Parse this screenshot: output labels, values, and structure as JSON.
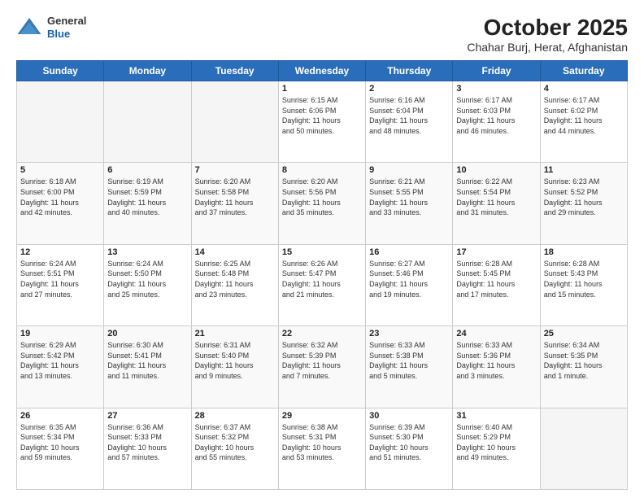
{
  "header": {
    "logo_general": "General",
    "logo_blue": "Blue",
    "title": "October 2025",
    "subtitle": "Chahar Burj, Herat, Afghanistan"
  },
  "days_of_week": [
    "Sunday",
    "Monday",
    "Tuesday",
    "Wednesday",
    "Thursday",
    "Friday",
    "Saturday"
  ],
  "weeks": [
    [
      {
        "day": "",
        "info": ""
      },
      {
        "day": "",
        "info": ""
      },
      {
        "day": "",
        "info": ""
      },
      {
        "day": "1",
        "info": "Sunrise: 6:15 AM\nSunset: 6:06 PM\nDaylight: 11 hours\nand 50 minutes."
      },
      {
        "day": "2",
        "info": "Sunrise: 6:16 AM\nSunset: 6:04 PM\nDaylight: 11 hours\nand 48 minutes."
      },
      {
        "day": "3",
        "info": "Sunrise: 6:17 AM\nSunset: 6:03 PM\nDaylight: 11 hours\nand 46 minutes."
      },
      {
        "day": "4",
        "info": "Sunrise: 6:17 AM\nSunset: 6:02 PM\nDaylight: 11 hours\nand 44 minutes."
      }
    ],
    [
      {
        "day": "5",
        "info": "Sunrise: 6:18 AM\nSunset: 6:00 PM\nDaylight: 11 hours\nand 42 minutes."
      },
      {
        "day": "6",
        "info": "Sunrise: 6:19 AM\nSunset: 5:59 PM\nDaylight: 11 hours\nand 40 minutes."
      },
      {
        "day": "7",
        "info": "Sunrise: 6:20 AM\nSunset: 5:58 PM\nDaylight: 11 hours\nand 37 minutes."
      },
      {
        "day": "8",
        "info": "Sunrise: 6:20 AM\nSunset: 5:56 PM\nDaylight: 11 hours\nand 35 minutes."
      },
      {
        "day": "9",
        "info": "Sunrise: 6:21 AM\nSunset: 5:55 PM\nDaylight: 11 hours\nand 33 minutes."
      },
      {
        "day": "10",
        "info": "Sunrise: 6:22 AM\nSunset: 5:54 PM\nDaylight: 11 hours\nand 31 minutes."
      },
      {
        "day": "11",
        "info": "Sunrise: 6:23 AM\nSunset: 5:52 PM\nDaylight: 11 hours\nand 29 minutes."
      }
    ],
    [
      {
        "day": "12",
        "info": "Sunrise: 6:24 AM\nSunset: 5:51 PM\nDaylight: 11 hours\nand 27 minutes."
      },
      {
        "day": "13",
        "info": "Sunrise: 6:24 AM\nSunset: 5:50 PM\nDaylight: 11 hours\nand 25 minutes."
      },
      {
        "day": "14",
        "info": "Sunrise: 6:25 AM\nSunset: 5:48 PM\nDaylight: 11 hours\nand 23 minutes."
      },
      {
        "day": "15",
        "info": "Sunrise: 6:26 AM\nSunset: 5:47 PM\nDaylight: 11 hours\nand 21 minutes."
      },
      {
        "day": "16",
        "info": "Sunrise: 6:27 AM\nSunset: 5:46 PM\nDaylight: 11 hours\nand 19 minutes."
      },
      {
        "day": "17",
        "info": "Sunrise: 6:28 AM\nSunset: 5:45 PM\nDaylight: 11 hours\nand 17 minutes."
      },
      {
        "day": "18",
        "info": "Sunrise: 6:28 AM\nSunset: 5:43 PM\nDaylight: 11 hours\nand 15 minutes."
      }
    ],
    [
      {
        "day": "19",
        "info": "Sunrise: 6:29 AM\nSunset: 5:42 PM\nDaylight: 11 hours\nand 13 minutes."
      },
      {
        "day": "20",
        "info": "Sunrise: 6:30 AM\nSunset: 5:41 PM\nDaylight: 11 hours\nand 11 minutes."
      },
      {
        "day": "21",
        "info": "Sunrise: 6:31 AM\nSunset: 5:40 PM\nDaylight: 11 hours\nand 9 minutes."
      },
      {
        "day": "22",
        "info": "Sunrise: 6:32 AM\nSunset: 5:39 PM\nDaylight: 11 hours\nand 7 minutes."
      },
      {
        "day": "23",
        "info": "Sunrise: 6:33 AM\nSunset: 5:38 PM\nDaylight: 11 hours\nand 5 minutes."
      },
      {
        "day": "24",
        "info": "Sunrise: 6:33 AM\nSunset: 5:36 PM\nDaylight: 11 hours\nand 3 minutes."
      },
      {
        "day": "25",
        "info": "Sunrise: 6:34 AM\nSunset: 5:35 PM\nDaylight: 11 hours\nand 1 minute."
      }
    ],
    [
      {
        "day": "26",
        "info": "Sunrise: 6:35 AM\nSunset: 5:34 PM\nDaylight: 10 hours\nand 59 minutes."
      },
      {
        "day": "27",
        "info": "Sunrise: 6:36 AM\nSunset: 5:33 PM\nDaylight: 10 hours\nand 57 minutes."
      },
      {
        "day": "28",
        "info": "Sunrise: 6:37 AM\nSunset: 5:32 PM\nDaylight: 10 hours\nand 55 minutes."
      },
      {
        "day": "29",
        "info": "Sunrise: 6:38 AM\nSunset: 5:31 PM\nDaylight: 10 hours\nand 53 minutes."
      },
      {
        "day": "30",
        "info": "Sunrise: 6:39 AM\nSunset: 5:30 PM\nDaylight: 10 hours\nand 51 minutes."
      },
      {
        "day": "31",
        "info": "Sunrise: 6:40 AM\nSunset: 5:29 PM\nDaylight: 10 hours\nand 49 minutes."
      },
      {
        "day": "",
        "info": ""
      }
    ]
  ]
}
